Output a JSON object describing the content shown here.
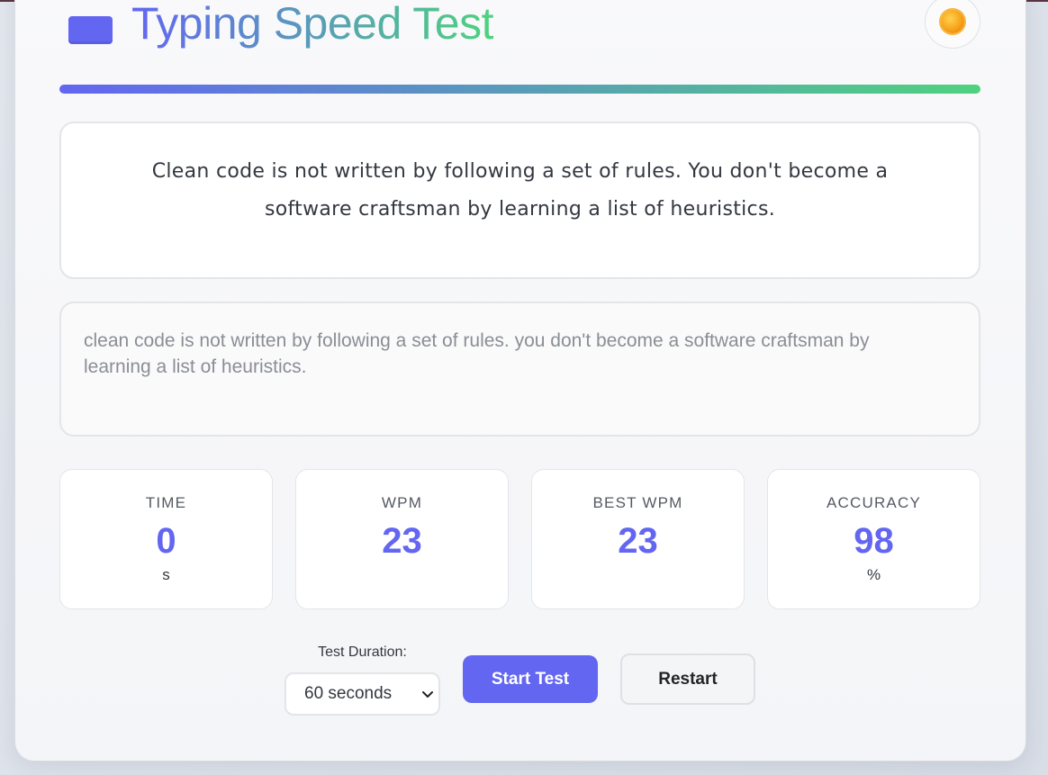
{
  "app": {
    "title": "Typing Speed Test",
    "icons": {
      "title_icon": "keyboard-icon",
      "theme_toggle": "sun-icon"
    },
    "colors": {
      "accent": "#6366f1",
      "gradient_end": "#4fd27f"
    }
  },
  "progress": {
    "fraction": 1.0
  },
  "quote": {
    "text": "Clean code is not written by following a set of rules. You don't become a software craftsman by learning a list of heuristics."
  },
  "typing_input": {
    "value": "clean code is not written by following a set of rules. you don't become a software craftsman by learning a list of heuristics."
  },
  "stats": [
    {
      "label": "TIME",
      "value": "0",
      "unit": "s"
    },
    {
      "label": "WPM",
      "value": "23",
      "unit": ""
    },
    {
      "label": "BEST WPM",
      "value": "23",
      "unit": ""
    },
    {
      "label": "ACCURACY",
      "value": "98",
      "unit": "%"
    }
  ],
  "controls": {
    "duration_label": "Test Duration:",
    "duration_selected": "60 seconds",
    "start_label": "Start Test",
    "restart_label": "Restart"
  }
}
